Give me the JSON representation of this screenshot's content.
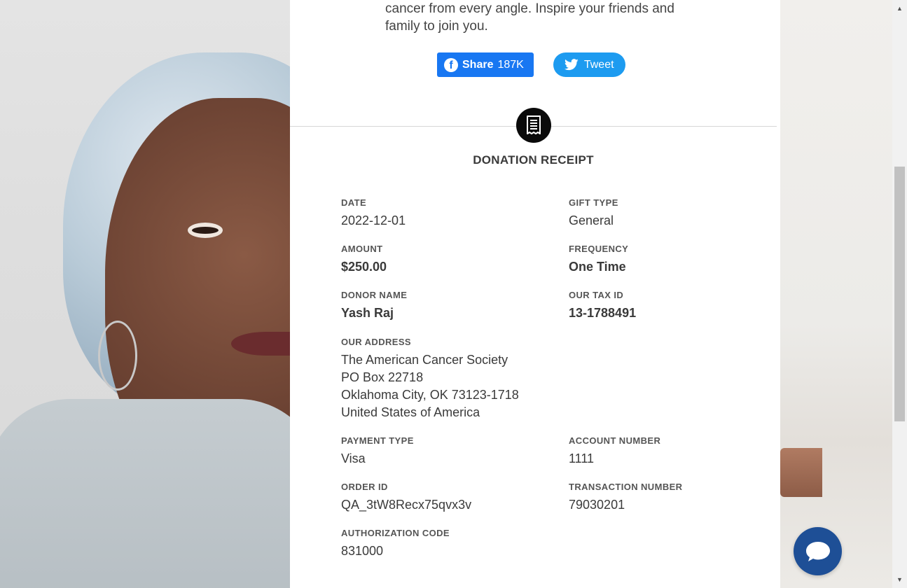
{
  "intro": {
    "line1": "cancer from every angle. Inspire your friends and",
    "line2": "family to join you."
  },
  "share": {
    "facebook_label": "Share",
    "facebook_count": "187K",
    "twitter_label": "Tweet"
  },
  "receipt": {
    "title": "DONATION RECEIPT",
    "date": {
      "label": "DATE",
      "value": "2022-12-01"
    },
    "gift_type": {
      "label": "GIFT TYPE",
      "value": "General"
    },
    "amount": {
      "label": "AMOUNT",
      "value": "$250.00"
    },
    "frequency": {
      "label": "FREQUENCY",
      "value": "One Time"
    },
    "donor_name": {
      "label": "DONOR NAME",
      "value": "Yash Raj"
    },
    "tax_id": {
      "label": "OUR TAX ID",
      "value": "13-1788491"
    },
    "address": {
      "label": "OUR ADDRESS",
      "lines": [
        "The American Cancer Society",
        "PO Box 22718",
        "Oklahoma City, OK 73123-1718",
        "United States of America"
      ]
    },
    "payment_type": {
      "label": "PAYMENT TYPE",
      "value": "Visa"
    },
    "account_number": {
      "label": "ACCOUNT NUMBER",
      "value": "1111"
    },
    "order_id": {
      "label": "ORDER ID",
      "value": "QA_3tW8Recx75qvx3v"
    },
    "transaction_number": {
      "label": "TRANSACTION NUMBER",
      "value": "79030201"
    },
    "authorization_code": {
      "label": "AUTHORIZATION CODE",
      "value": "831000"
    }
  },
  "colors": {
    "facebook": "#1877f2",
    "twitter": "#1d9bf0",
    "chat": "#1e4f96"
  },
  "icons": {
    "receipt": "receipt-icon",
    "facebook": "facebook-icon",
    "twitter": "twitter-bird-icon",
    "chat": "chat-bubble-icon"
  }
}
